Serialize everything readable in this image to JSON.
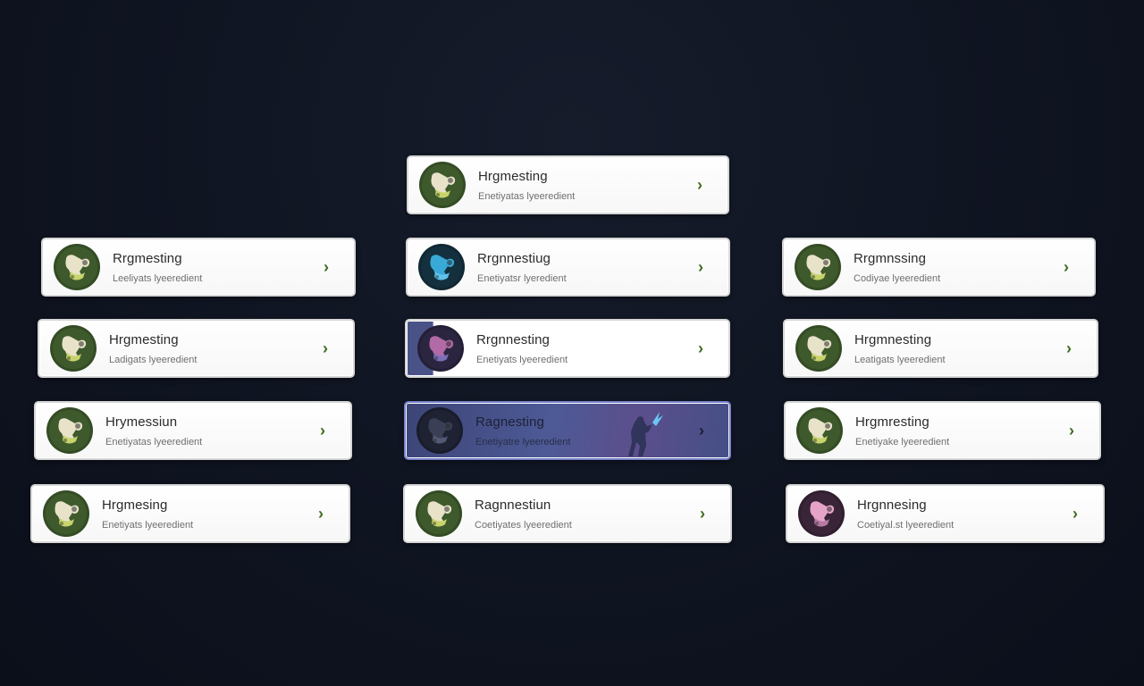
{
  "cards": [
    {
      "title": "Hrgmesting",
      "subtitle": "Enetiyatas lyeeredient",
      "icon": "wrench-icon",
      "icon_bg": "#3e5a2c",
      "icon_fg": "#e8e2c9",
      "icon_accent": "#c7d36b"
    },
    {
      "title": "Rrgmesting",
      "subtitle": "Leeliyats lyeeredient",
      "icon": "wrench-icon",
      "icon_bg": "#3e5a2c",
      "icon_fg": "#e8e2c9",
      "icon_accent": "#c7d36b"
    },
    {
      "title": "Rrgnnestiug",
      "subtitle": "Enetiyatsr lyeredient",
      "icon": "wrench-icon",
      "icon_bg": "#14303e",
      "icon_fg": "#39a9d8",
      "icon_accent": "#5fc3ea"
    },
    {
      "title": "Rrgmnssing",
      "subtitle": "Codiyae lyeeredient",
      "icon": "wrench-icon",
      "icon_bg": "#3e5a2c",
      "icon_fg": "#e8e2c9",
      "icon_accent": "#c7d36b"
    },
    {
      "title": "Hrgmesting",
      "subtitle": "Ladigats lyeeredient",
      "icon": "wrench-icon",
      "icon_bg": "#3e5a2c",
      "icon_fg": "#e8e2c9",
      "icon_accent": "#c7d36b"
    },
    {
      "title": "Rrgnnesting",
      "subtitle": "Enetiyats lyeeredient",
      "icon": "wrench-icon",
      "icon_bg": "#2b2540",
      "icon_fg": "#b16aa6",
      "icon_accent": "#7b6fb8"
    },
    {
      "title": "Hrgmnesting",
      "subtitle": "Leatigats lyeeredient",
      "icon": "wrench-icon",
      "icon_bg": "#3e5a2c",
      "icon_fg": "#e8e2c9",
      "icon_accent": "#c7d36b"
    },
    {
      "title": "Hrymessiun",
      "subtitle": "Enetiyatas lyeeredient",
      "icon": "wrench-icon",
      "icon_bg": "#3e5a2c",
      "icon_fg": "#e8e2c9",
      "icon_accent": "#c7d36b"
    },
    {
      "title": "Ragnesting",
      "subtitle": "Enetiyatre lyeeredient",
      "icon": "wrench-icon",
      "icon_bg": "#1e2233",
      "icon_fg": "#3a3f55",
      "icon_accent": "#545a75"
    },
    {
      "title": "Hrgmresting",
      "subtitle": "Enetiyake lyeeredient",
      "icon": "wrench-icon",
      "icon_bg": "#3e5a2c",
      "icon_fg": "#e8e2c9",
      "icon_accent": "#c7d36b"
    },
    {
      "title": "Hrgmesing",
      "subtitle": "Enetiyats lyeeredient",
      "icon": "wrench-icon",
      "icon_bg": "#3e5a2c",
      "icon_fg": "#e8e2c9",
      "icon_accent": "#c7d36b"
    },
    {
      "title": "Ragnnestiun",
      "subtitle": "Coetiyates lyeeredient",
      "icon": "wrench-icon",
      "icon_bg": "#3e5a2c",
      "icon_fg": "#e8e2c9",
      "icon_accent": "#c7d36b"
    },
    {
      "title": "Hrgnnesing",
      "subtitle": "Coetiyal.st lyeeredient",
      "icon": "wrench-icon",
      "icon_bg": "#3a2438",
      "icon_fg": "#e6a3c8",
      "icon_accent": "#b77aa4"
    }
  ],
  "chevron": "›",
  "colors": {
    "accent": "#3f6b1d",
    "selected": "#4d5a96"
  }
}
